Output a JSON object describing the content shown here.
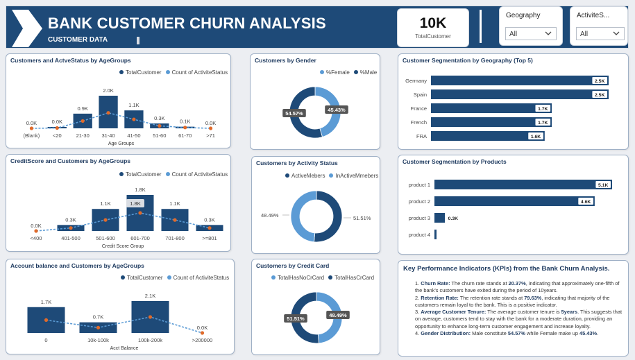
{
  "header": {
    "title": "BANK CUSTOMER CHURN ANALYSIS",
    "subtitle": "CUSTOMER DATA",
    "kpi_value": "10K",
    "kpi_label": "TotalCustomer",
    "slicer_geography": {
      "title": "Geography",
      "value": "All"
    },
    "slicer_activity": {
      "title": "ActiviteS...",
      "value": "All"
    }
  },
  "colors": {
    "navy": "#1e4a78",
    "light_blue": "#5b9bd5",
    "orange": "#e06a2a"
  },
  "age_chart": {
    "title": "Customers and ActveStatus by AgeGroups",
    "legend": [
      "TotalCustomer",
      "Count of ActiviteStatus"
    ],
    "xlabel": "Age Groups",
    "categories": [
      "(Blank)",
      "<20",
      "21-30",
      "31-40",
      "41-50",
      "51-60",
      "61-70",
      ">71"
    ],
    "labels": [
      "0.0K",
      "0.0K",
      "0.9K",
      "2.0K",
      "1.1K",
      "0.3K",
      "0.1K",
      "0.0K"
    ]
  },
  "credit_chart": {
    "title": "CreditScore and Customers by AgeGroups",
    "legend": [
      "TotalCustomer",
      "Count of ActiviteStatus"
    ],
    "xlabel": "Credit Score Group",
    "categories": [
      "<400",
      "401-500",
      "501-600",
      "601-700",
      "701-800",
      ">=801"
    ],
    "labels": [
      "0.0K",
      "0.3K",
      "1.1K",
      "1.8K",
      "1.1K",
      "0.3K"
    ],
    "inner_label": "1.8K"
  },
  "balance_chart": {
    "title": "Account balance and Customers by AgeGroups",
    "legend": [
      "TotalCustomer",
      "Count of ActiviteStatus"
    ],
    "xlabel": "Acct Balance",
    "categories": [
      "0",
      "10k-100k",
      "100k-200k",
      ">200000"
    ],
    "labels": [
      "1.7K",
      "0.7K",
      "2.1K",
      "0.0K"
    ]
  },
  "gender_chart": {
    "title": "Customers by Gender",
    "legend": [
      "%Female",
      "%Male"
    ],
    "labels": [
      "54.57%",
      "45.43%"
    ]
  },
  "activity_chart": {
    "title": "Customers by Activity Status",
    "legend": [
      "ActiveMebers",
      "InActiveMmebers"
    ],
    "labels": [
      "48.49%",
      "51.51%"
    ]
  },
  "card_chart": {
    "title": "Customers by Credit Card",
    "legend": [
      "TotalHasNoCrCard",
      "TotalHasCrCard"
    ],
    "labels": [
      "51.51%",
      "48.49%"
    ]
  },
  "geo_chart": {
    "title": "Customer Segmentation by Geography (Top 5)",
    "categories": [
      "Germany",
      "Spain",
      "France",
      "French",
      "FRA"
    ],
    "labels": [
      "2.5K",
      "2.5K",
      "1.7K",
      "1.7K",
      "1.6K"
    ]
  },
  "product_chart": {
    "title": "Customer Segmentation by Products",
    "categories": [
      "product 1",
      "product 2",
      "product 3",
      "product 4"
    ],
    "labels": [
      "5.1K",
      "4.6K",
      "0.3K",
      ""
    ]
  },
  "kpi_panel": {
    "title": "Key Performance Indicators (KPIs) from the Bank Churn Analysis.",
    "items": [
      {
        "num": "1.",
        "head": "Churn Rate:",
        "pre": " The churn rate stands at ",
        "bold": "20.37%",
        "post": ", indicating that approximately one-fifth of the bank's customers have exited during the period of 10years."
      },
      {
        "num": "2.",
        "head": " Retention Rate:",
        "pre": " The  retention rate stands at ",
        "bold": "79.63%",
        "post": ", indicating that majority of the customers remain loyal to the bank. This is a positive indicator."
      },
      {
        "num": "3.",
        "head": "Average Customer Tenure:",
        "pre": " The average customer tenure is ",
        "bold": "5years",
        "post": ". This suggests that on average, customers tend to stay with the bank for a moderate duration, providing an opportunity to enhance long-term customer engagement and increase loyalty."
      },
      {
        "num": "4.",
        "head": "Gender Distribution:",
        "pre": " Male constitute ",
        "bold": "54.57%",
        "post": "  while Female make up ",
        "bold2": "45.43%",
        "post2": "."
      }
    ]
  },
  "chart_data": [
    {
      "type": "bar",
      "title": "Customers and ActveStatus by AgeGroups",
      "xlabel": "Age Groups",
      "categories": [
        "(Blank)",
        "<20",
        "21-30",
        "31-40",
        "41-50",
        "51-60",
        "61-70",
        ">71"
      ],
      "series": [
        {
          "name": "TotalCustomer",
          "values": [
            0.0,
            0.05,
            0.9,
            2.0,
            1.1,
            0.3,
            0.1,
            0.0
          ]
        },
        {
          "name": "Count of ActiviteStatus",
          "values": [
            0.0,
            0.02,
            0.45,
            0.95,
            0.55,
            0.15,
            0.05,
            0.0
          ]
        }
      ]
    },
    {
      "type": "bar",
      "title": "CreditScore and Customers by AgeGroups",
      "xlabel": "Credit Score Group",
      "categories": [
        "<400",
        "401-500",
        "501-600",
        "601-700",
        "701-800",
        ">=801"
      ],
      "series": [
        {
          "name": "TotalCustomer",
          "values": [
            0.0,
            0.3,
            1.1,
            1.8,
            1.1,
            0.3
          ]
        },
        {
          "name": "Count of ActiviteStatus",
          "values": [
            0.0,
            0.15,
            0.55,
            0.9,
            0.55,
            0.15
          ]
        }
      ]
    },
    {
      "type": "bar",
      "title": "Account balance and Customers by AgeGroups",
      "xlabel": "Acct Balance",
      "categories": [
        "0",
        "10k-100k",
        "100k-200k",
        ">200000"
      ],
      "series": [
        {
          "name": "TotalCustomer",
          "values": [
            1.7,
            0.7,
            2.1,
            0.0
          ]
        },
        {
          "name": "Count of ActiviteStatus",
          "values": [
            0.85,
            0.35,
            1.05,
            0.0
          ]
        }
      ]
    },
    {
      "type": "pie",
      "title": "Customers by Gender",
      "categories": [
        "%Female",
        "%Male"
      ],
      "values": [
        45.43,
        54.57
      ]
    },
    {
      "type": "pie",
      "title": "Customers by Activity Status",
      "categories": [
        "ActiveMebers",
        "InActiveMmebers"
      ],
      "values": [
        51.51,
        48.49
      ]
    },
    {
      "type": "pie",
      "title": "Customers by Credit Card",
      "categories": [
        "TotalHasNoCrCard",
        "TotalHasCrCard"
      ],
      "values": [
        48.49,
        51.51
      ]
    },
    {
      "type": "bar",
      "title": "Customer Segmentation by Geography (Top 5)",
      "categories": [
        "Germany",
        "Spain",
        "France",
        "French",
        "FRA"
      ],
      "values": [
        2.5,
        2.5,
        1.7,
        1.7,
        1.6
      ]
    },
    {
      "type": "bar",
      "title": "Customer Segmentation by Products",
      "categories": [
        "product 1",
        "product 2",
        "product 3",
        "product 4"
      ],
      "values": [
        5.1,
        4.6,
        0.3,
        0.06
      ]
    }
  ]
}
